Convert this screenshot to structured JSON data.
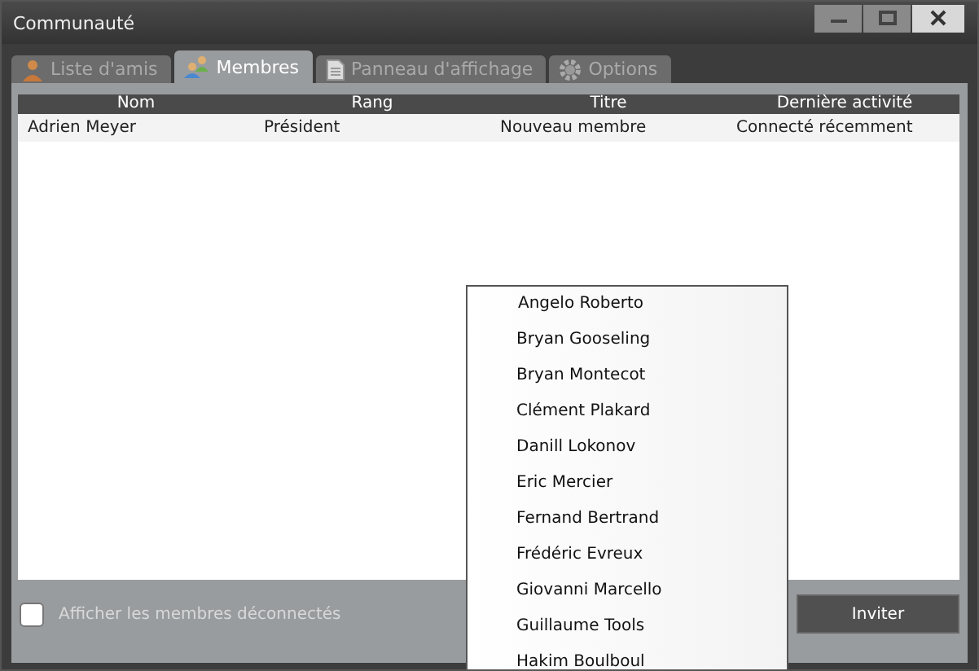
{
  "window": {
    "title": "Communauté"
  },
  "tabs": [
    {
      "label": "Liste d'amis",
      "selected": false
    },
    {
      "label": "Membres",
      "selected": true
    },
    {
      "label": "Panneau d'affichage",
      "selected": false
    },
    {
      "label": "Options",
      "selected": false
    }
  ],
  "table": {
    "columns": [
      "Nom",
      "Rang",
      "Titre",
      "Dernière activité"
    ],
    "rows": [
      [
        "Adrien Meyer",
        "Président",
        "Nouveau membre",
        "Connecté récemment"
      ]
    ]
  },
  "show_offline": {
    "label": "Afficher les membres déconnectés",
    "checked": false
  },
  "invite_button": "Inviter",
  "dropdown": [
    "Angelo Roberto",
    "Bryan Gooseling",
    "Bryan Montecot",
    "Clément Plakard",
    "Danill Lokonov",
    "Eric Mercier",
    "Fernand Bertrand",
    "Frédéric Evreux",
    "Giovanni Marcello",
    "Guillaume Tools",
    "Hakim Boulboul"
  ]
}
